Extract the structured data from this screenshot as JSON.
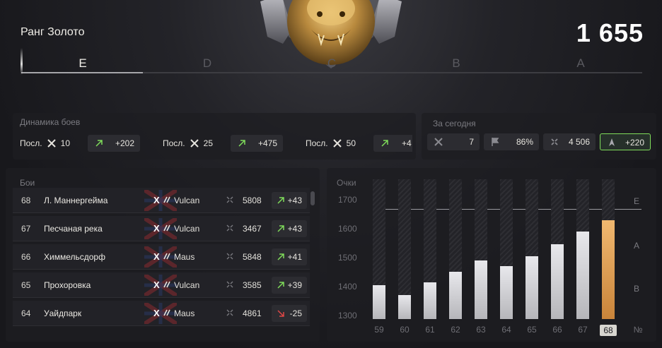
{
  "rank": {
    "title": "Ранг Золото",
    "score": "1 655"
  },
  "tiers": [
    {
      "letter": "E",
      "active": true
    },
    {
      "letter": "D",
      "active": false
    },
    {
      "letter": "C",
      "active": false
    },
    {
      "letter": "B",
      "active": false
    },
    {
      "letter": "A",
      "active": false
    }
  ],
  "dynamics": {
    "label": "Динамика боев",
    "items": [
      {
        "prefix": "Посл.",
        "count": "10",
        "delta": "+202"
      },
      {
        "prefix": "Посл.",
        "count": "25",
        "delta": "+475"
      },
      {
        "prefix": "Посл.",
        "count": "50",
        "delta": "+4"
      }
    ]
  },
  "today": {
    "label": "За сегодня",
    "stats": [
      {
        "icon": "crossed-swords-icon",
        "value": "7"
      },
      {
        "icon": "flag-icon",
        "value": "86%"
      },
      {
        "icon": "experience-icon",
        "value": "4 506"
      },
      {
        "icon": "rank-arrow-icon",
        "value": "+220"
      }
    ]
  },
  "battles": {
    "label": "Бои",
    "rows": [
      {
        "num": "68",
        "map": "Л. Маннергейма",
        "tier": "X",
        "tank": "Vulcan",
        "exp": "5808",
        "delta": "+43",
        "positive": true
      },
      {
        "num": "67",
        "map": "Песчаная река",
        "tier": "X",
        "tank": "Vulcan",
        "exp": "3467",
        "delta": "+43",
        "positive": true
      },
      {
        "num": "66",
        "map": "Химмельсдорф",
        "tier": "X",
        "tank": "Maus",
        "exp": "5848",
        "delta": "+41",
        "positive": true
      },
      {
        "num": "65",
        "map": "Прохоровка",
        "tier": "X",
        "tank": "Vulcan",
        "exp": "3585",
        "delta": "+39",
        "positive": true
      },
      {
        "num": "64",
        "map": "Уайдпарк",
        "tier": "X",
        "tank": "Maus",
        "exp": "4861",
        "delta": "-25",
        "positive": false
      }
    ]
  },
  "chart_data": {
    "type": "bar",
    "ylabel": "Очки",
    "xlabel": "№",
    "yticks": [
      "1700",
      "1600",
      "1500",
      "1400",
      "1300"
    ],
    "ylim": [
      1300,
      1750
    ],
    "reference_line": 1655,
    "bands": [
      "E",
      "A",
      "B"
    ],
    "categories": [
      "59",
      "60",
      "61",
      "62",
      "63",
      "64",
      "65",
      "66",
      "67",
      "68"
    ],
    "values": [
      1410,
      1378,
      1418,
      1452,
      1488,
      1470,
      1502,
      1540,
      1582,
      1618
    ],
    "highlight": "68",
    "colors": {
      "bar": "#d4d4d8",
      "highlight": "#e0a050"
    }
  }
}
